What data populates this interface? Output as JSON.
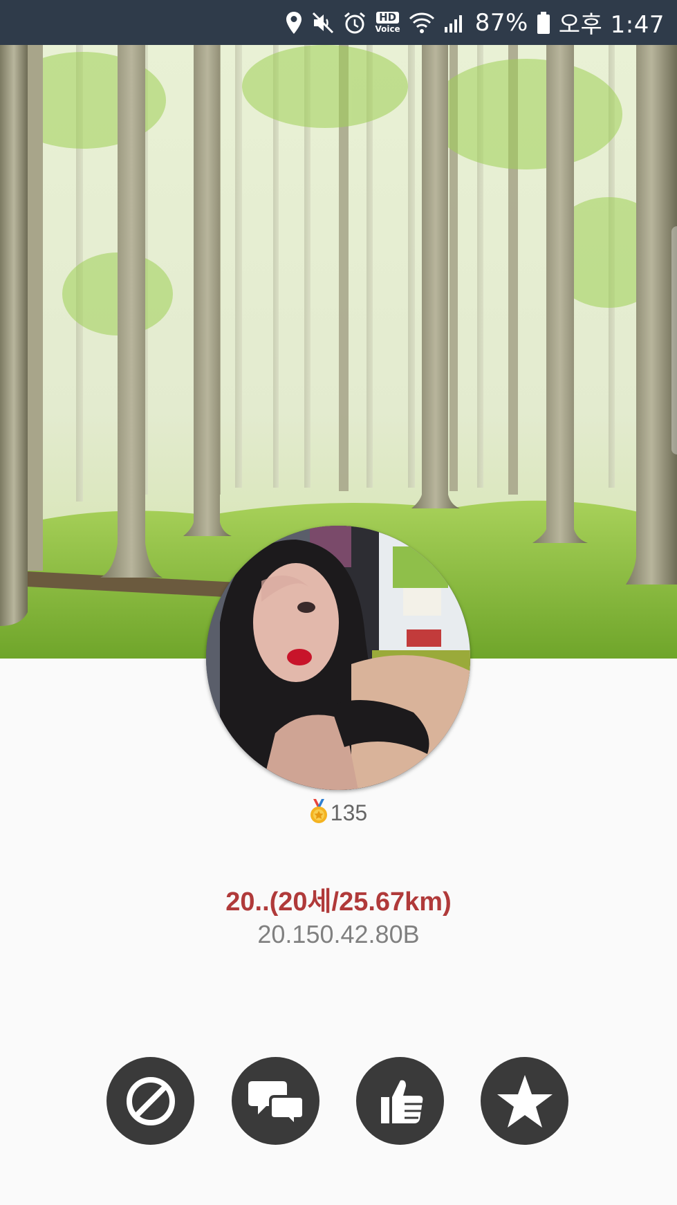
{
  "status_bar": {
    "battery": "87%",
    "time": "오후 1:47",
    "hd_label": "HD",
    "voice_label": "Voice",
    "icons": [
      "location-icon",
      "mute-icon",
      "alarm-icon",
      "hd-voice-icon",
      "wifi-icon",
      "signal-icon",
      "battery-icon"
    ]
  },
  "profile": {
    "rank_icon": "medal-icon",
    "rank_value": "135",
    "name_line": "20..(20세/25.67km)",
    "id_line": "20.150.42.80B"
  },
  "actions": [
    {
      "icon": "block-icon"
    },
    {
      "icon": "chat-icon"
    },
    {
      "icon": "thumbs-up-icon"
    },
    {
      "icon": "star-icon"
    }
  ],
  "colors": {
    "status_bar_bg": "#2f3b4a",
    "name_color": "#b03a3a",
    "id_color": "#808080",
    "button_bg": "#3a3a3a",
    "page_bg": "#fafafa"
  }
}
